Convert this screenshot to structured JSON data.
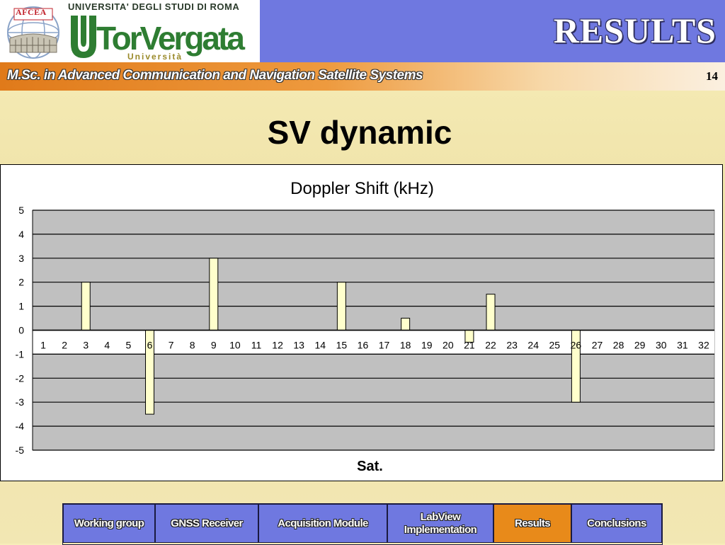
{
  "header": {
    "seal_label": "AFCEA",
    "university_line": "UNIVERSITA' DEGLI STUDI DI ROMA",
    "logo_text": "TorVergata",
    "logo_sub": "Università",
    "section_title": "RESULTS",
    "subtitle": "M.Sc. in Advanced Communication and Navigation Satellite Systems",
    "page_number": "14"
  },
  "slide": {
    "title": "SV dynamic"
  },
  "colors": {
    "header_blue": "#6f78e0",
    "orange": "#e88a1a",
    "plot_gray": "#c0c0c0",
    "bar_fill": "#ffffcc"
  },
  "chart_data": {
    "type": "bar",
    "title": "Doppler Shift (kHz)",
    "xlabel": "Sat.",
    "ylabel": "",
    "ylim": [
      -5,
      5
    ],
    "yticks": [
      5,
      4,
      3,
      2,
      1,
      0,
      -1,
      -2,
      -3,
      -4,
      -5
    ],
    "grid": true,
    "categories": [
      "1",
      "2",
      "3",
      "4",
      "5",
      "6",
      "7",
      "8",
      "9",
      "10",
      "11",
      "12",
      "13",
      "14",
      "15",
      "16",
      "17",
      "18",
      "19",
      "20",
      "21",
      "22",
      "23",
      "24",
      "25",
      "26",
      "27",
      "28",
      "29",
      "30",
      "31",
      "32"
    ],
    "values": [
      0,
      0,
      2,
      0,
      0,
      -3.5,
      0,
      0,
      3,
      0,
      0,
      0,
      0,
      0,
      2,
      0,
      0,
      0.5,
      0,
      0,
      -0.5,
      1.5,
      0,
      0,
      0,
      -3,
      0,
      0,
      0,
      0,
      0,
      0
    ]
  },
  "nav": {
    "items": [
      {
        "label": "Working group",
        "active": false
      },
      {
        "label": "GNSS Receiver",
        "active": false
      },
      {
        "label": "Acquisition Module",
        "active": false
      },
      {
        "label": "LabView Implementation",
        "active": false
      },
      {
        "label": "Results",
        "active": true
      },
      {
        "label": "Conclusions",
        "active": false
      }
    ]
  }
}
